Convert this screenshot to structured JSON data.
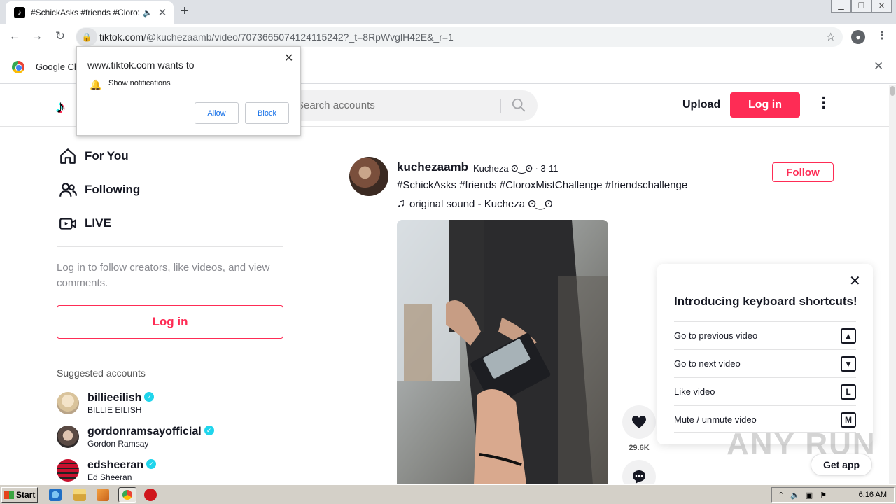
{
  "browser": {
    "tab_title": "#SchickAsks #friends #CloroxMistChallenge",
    "url_host": "tiktok.com",
    "url_path": "/@kuchezaamb/video/7073665074124115242?_t=8RpWvglH42E&_r=1",
    "infobar_text": "Google Ch"
  },
  "permission_popup": {
    "title": "www.tiktok.com wants to",
    "item": "Show notifications",
    "allow_label": "Allow",
    "block_label": "Block"
  },
  "header": {
    "search_placeholder": "Search accounts",
    "upload_label": "Upload",
    "login_label": "Log in"
  },
  "sidebar": {
    "nav": [
      {
        "label": "For You",
        "icon": "home-icon"
      },
      {
        "label": "Following",
        "icon": "users-icon"
      },
      {
        "label": "LIVE",
        "icon": "live-icon"
      }
    ],
    "login_prompt": "Log in to follow creators, like videos, and view comments.",
    "login_button": "Log in",
    "suggested_title": "Suggested accounts",
    "accounts": [
      {
        "username": "billieeilish",
        "nickname": "BILLIE EILISH"
      },
      {
        "username": "gordonramsayofficial",
        "nickname": "Gordon Ramsay"
      },
      {
        "username": "edsheeran",
        "nickname": "Ed Sheeran"
      }
    ]
  },
  "post": {
    "username": "kuchezaamb",
    "nickname_date": "Kucheza ʘ‿ʘ · 3-11",
    "caption": "#SchickAsks #friends #CloroxMistChallenge #friendschallenge",
    "music": "original sound - Kucheza ʘ‿ʘ",
    "follow_label": "Follow",
    "like_count": "29.6K"
  },
  "shortcuts_panel": {
    "title": "Introducing keyboard shortcuts!",
    "items": [
      {
        "label": "Go to previous video",
        "key": "▲"
      },
      {
        "label": "Go to next video",
        "key": "▼"
      },
      {
        "label": "Like video",
        "key": "L"
      },
      {
        "label": "Mute / unmute video",
        "key": "M"
      }
    ]
  },
  "get_app_label": "Get app",
  "watermark": "ANY RUN",
  "taskbar": {
    "start_label": "Start",
    "clock": "6:16 AM"
  },
  "colors": {
    "brand": "#fe2c55",
    "verified": "#20d5ec",
    "text": "#161823"
  }
}
